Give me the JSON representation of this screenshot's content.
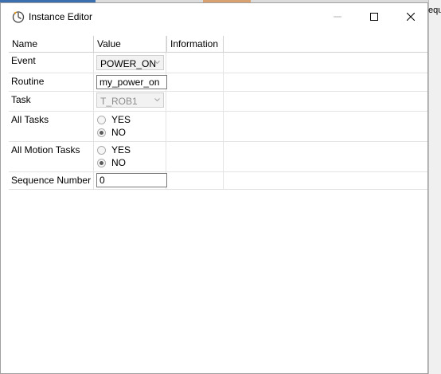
{
  "window": {
    "title": "Instance Editor"
  },
  "grid": {
    "headers": {
      "name": "Name",
      "value": "Value",
      "info": "Information"
    },
    "rows": {
      "event": {
        "name": "Event",
        "value": "POWER_ON"
      },
      "routine": {
        "name": "Routine",
        "value": "my_power_on"
      },
      "task": {
        "name": "Task",
        "value": "T_ROB1"
      },
      "all_tasks": {
        "name": "All Tasks",
        "yes": "YES",
        "no": "NO",
        "selected": "NO"
      },
      "all_motion_tasks": {
        "name": "All Motion Tasks",
        "yes": "YES",
        "no": "NO",
        "selected": "NO"
      },
      "sequence_number": {
        "name": "Sequence Number",
        "value": "0"
      }
    }
  },
  "background": {
    "partial_text": "equ"
  },
  "icons": {
    "app": "instance-editor-icon",
    "minimize": "minimize-icon",
    "maximize": "maximize-icon",
    "close": "close-icon",
    "dropdown": "chevron-down-icon"
  },
  "colors": {
    "window_border": "#a0a0a0",
    "grid_line": "#e3e3e3",
    "disabled_text": "#8c8c8c",
    "textbox_border": "#7a7a7a"
  }
}
